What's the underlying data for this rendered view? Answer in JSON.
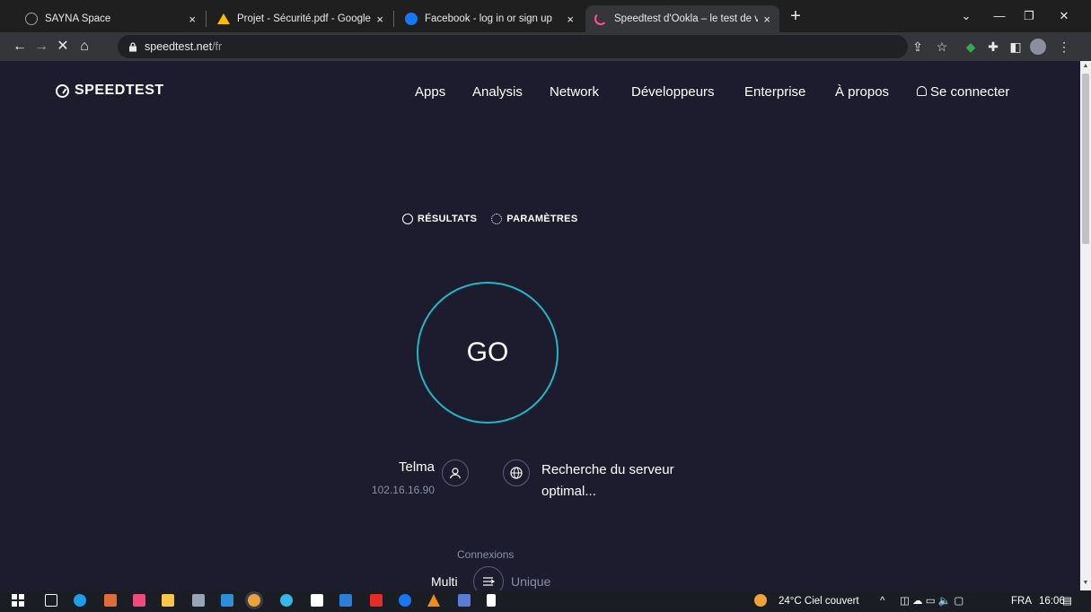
{
  "browser": {
    "tabs": [
      {
        "title": "SAYNA Space",
        "icon": "sayna-icon",
        "color": "#9aa0a6"
      },
      {
        "title": "Projet - Sécurité.pdf - Google Dri",
        "icon": "google-drive-icon",
        "color": "#fbbc04"
      },
      {
        "title": "Facebook - log in or sign up",
        "icon": "facebook-icon",
        "color": "#1877f2"
      },
      {
        "title": "Speedtest d'Ookla – le test de vit",
        "icon": "loading-spinner-icon",
        "color": "#ff4fa3"
      }
    ],
    "close_glyph": "×",
    "new_tab_glyph": "+",
    "url_host": "speedtest.net",
    "url_path": "/fr"
  },
  "site": {
    "logo": "SPEEDTEST",
    "nav": [
      "Apps",
      "Analysis",
      "Network",
      "Développeurs",
      "Enterprise",
      "À propos",
      "Se connecter"
    ],
    "subnav": {
      "results": "RÉSULTATS",
      "settings": "PARAMÈTRES"
    },
    "go_label": "GO",
    "isp": {
      "name": "Telma",
      "ip": "102.16.16.90"
    },
    "server": {
      "text": "Recherche du serveur optimal..."
    },
    "connections": {
      "label": "Connexions",
      "multi": "Multi",
      "unique": "Unique"
    },
    "accent_color": "#1fb8c4",
    "background_color": "#1c1c2e"
  },
  "taskbar": {
    "weather": "24°C  Ciel couvert",
    "language": "FRA",
    "time": "16:06"
  }
}
